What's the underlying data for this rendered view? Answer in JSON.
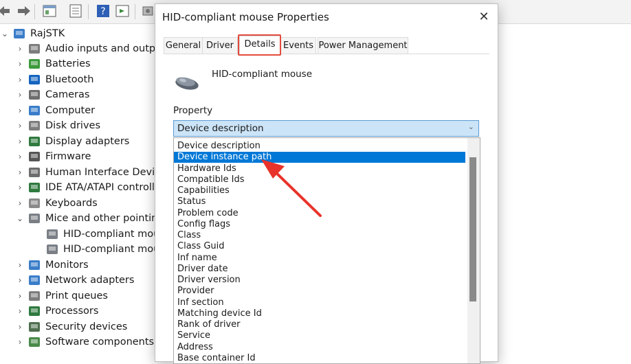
{
  "tree": {
    "root": "RajSTK",
    "items": [
      {
        "label": "Audio inputs and outputs",
        "icon": "speaker-icon",
        "expanded": false
      },
      {
        "label": "Batteries",
        "icon": "battery-icon",
        "expanded": false
      },
      {
        "label": "Bluetooth",
        "icon": "bluetooth-icon",
        "expanded": false
      },
      {
        "label": "Cameras",
        "icon": "camera-icon",
        "expanded": false
      },
      {
        "label": "Computer",
        "icon": "computer-icon",
        "expanded": false
      },
      {
        "label": "Disk drives",
        "icon": "disk-drive-icon",
        "expanded": false
      },
      {
        "label": "Display adapters",
        "icon": "display-adapter-icon",
        "expanded": false
      },
      {
        "label": "Firmware",
        "icon": "firmware-icon",
        "expanded": false
      },
      {
        "label": "Human Interface Devices",
        "icon": "hid-icon",
        "expanded": false
      },
      {
        "label": "IDE ATA/ATAPI controllers",
        "icon": "ide-controller-icon",
        "expanded": false
      },
      {
        "label": "Keyboards",
        "icon": "keyboard-icon",
        "expanded": false
      },
      {
        "label": "Mice and other pointing devices",
        "icon": "mouse-icon",
        "expanded": true
      },
      {
        "label": "HID-compliant mouse",
        "icon": "mouse-icon",
        "child": true
      },
      {
        "label": "HID-compliant mouse",
        "icon": "mouse-icon",
        "child": true
      },
      {
        "label": "Monitors",
        "icon": "monitor-icon",
        "expanded": false
      },
      {
        "label": "Network adapters",
        "icon": "network-adapter-icon",
        "expanded": false
      },
      {
        "label": "Print queues",
        "icon": "printer-icon",
        "expanded": false
      },
      {
        "label": "Processors",
        "icon": "processor-icon",
        "expanded": false
      },
      {
        "label": "Security devices",
        "icon": "security-device-icon",
        "expanded": false
      },
      {
        "label": "Software components",
        "icon": "software-component-icon",
        "expanded": false
      }
    ]
  },
  "dialog": {
    "title": "HID-compliant mouse Properties",
    "close_glyph": "✕",
    "tabs": [
      {
        "label": "General",
        "active": false
      },
      {
        "label": "Driver",
        "active": false
      },
      {
        "label": "Details",
        "active": true
      },
      {
        "label": "Events",
        "active": false
      },
      {
        "label": "Power Management",
        "active": false
      }
    ],
    "device_name": "HID-compliant mouse",
    "property_label": "Property",
    "property_selected": "Device description",
    "property_options": [
      "Device description",
      "Device instance path",
      "Hardware Ids",
      "Compatible Ids",
      "Capabilities",
      "Status",
      "Problem code",
      "Config flags",
      "Class",
      "Class Guid",
      "Inf name",
      "Driver date",
      "Driver version",
      "Provider",
      "Inf section",
      "Matching device Id",
      "Rank of driver",
      "Service",
      "Address",
      "Base container Id"
    ],
    "highlighted_option": "Device instance path"
  },
  "colors": {
    "selection": "#0078d7",
    "annotation": "#e34b3c",
    "select_bg": "#cce4f7"
  }
}
